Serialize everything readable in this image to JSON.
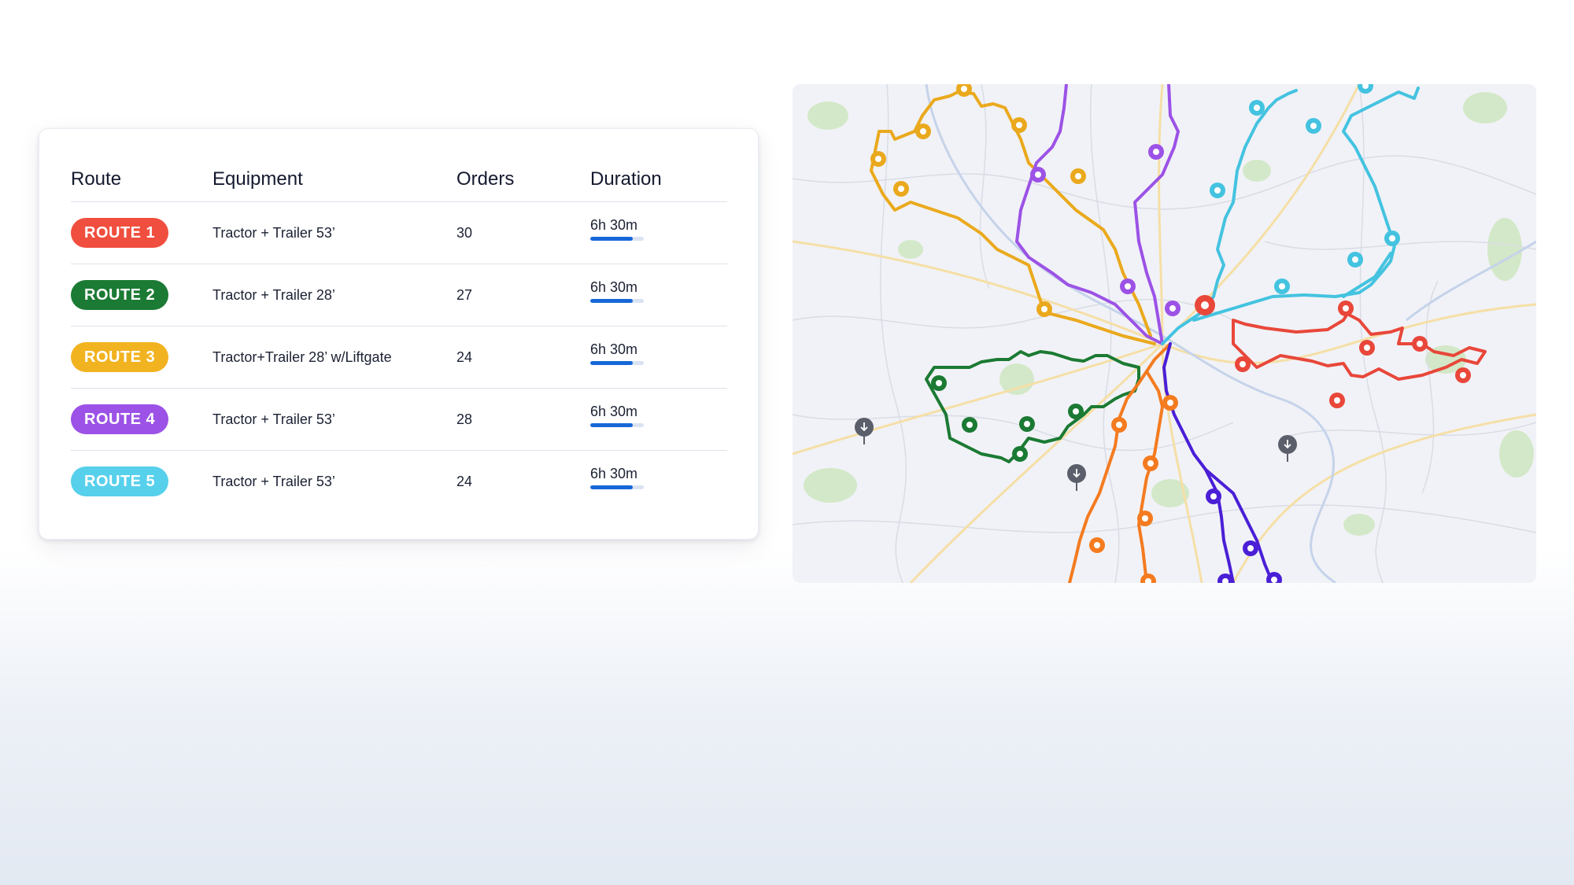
{
  "table": {
    "headers": {
      "route": "Route",
      "equipment": "Equipment",
      "orders": "Orders",
      "duration": "Duration"
    },
    "rows": [
      {
        "route": "ROUTE 1",
        "color": "#f04e3e",
        "equipment": "Tractor + Trailer 53’",
        "orders": "30",
        "duration": "6h 30m",
        "duration_fill": 0.8
      },
      {
        "route": "ROUTE 2",
        "color": "#1b7a33",
        "equipment": "Tractor + Trailer 28’",
        "orders": "27",
        "duration": "6h 30m",
        "duration_fill": 0.8
      },
      {
        "route": "ROUTE 3",
        "color": "#f2b321",
        "equipment": "Tractor+Trailer 28’ w/Liftgate",
        "orders": "24",
        "duration": "6h 30m",
        "duration_fill": 0.8
      },
      {
        "route": "ROUTE 4",
        "color": "#9c52e6",
        "equipment": "Tractor + Trailer 53’",
        "orders": "28",
        "duration": "6h 30m",
        "duration_fill": 0.8
      },
      {
        "route": "ROUTE 5",
        "color": "#57d0ec",
        "equipment": "Tractor + Trailer 53’",
        "orders": "24",
        "duration": "6h 30m",
        "duration_fill": 0.8
      }
    ]
  },
  "map": {
    "route_colors": {
      "route_1": "#f04e3e",
      "route_2": "#1b7a33",
      "route_3": "#f2b321",
      "route_4": "#9c52e6",
      "route_5": "#44c3e0",
      "route_orange": "#f47b20",
      "route_indigo": "#4a1fd6"
    },
    "depot_marker_icon": "download-pin-icon"
  }
}
